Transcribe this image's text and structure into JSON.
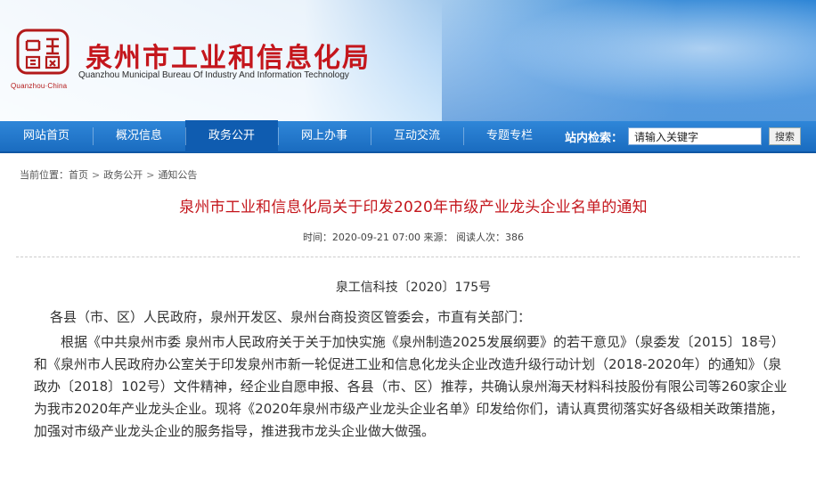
{
  "header": {
    "logo_text": "Quanzhou·China",
    "title": "泉州市工业和信息化局",
    "subtitle": "Quanzhou Municipal Bureau Of Industry And Information Technology"
  },
  "nav": {
    "items": [
      {
        "label": "网站首页"
      },
      {
        "label": "概况信息"
      },
      {
        "label": "政务公开"
      },
      {
        "label": "网上办事"
      },
      {
        "label": "互动交流"
      },
      {
        "label": "专题专栏"
      }
    ],
    "search_label": "站内检索：",
    "search_value": "请输入关键字",
    "search_button": "搜索"
  },
  "breadcrumb": {
    "prefix": "当前位置：",
    "items": [
      "首页",
      "政务公开",
      "通知公告"
    ],
    "separator": ">"
  },
  "article": {
    "title": "泉州市工业和信息化局关于印发2020年市级产业龙头企业名单的通知",
    "meta": "时间：2020-09-21 07:00 来源：  阅读人次：386",
    "doc_number": "泉工信科技〔2020〕175号",
    "salutation": "各县（市、区）人民政府，泉州开发区、泉州台商投资区管委会，市直有关部门：",
    "body": "根据《中共泉州市委 泉州市人民政府关于关于加快实施《泉州制造2025发展纲要》的若干意见》（泉委发〔2015〕18号）和《泉州市人民政府办公室关于印发泉州市新一轮促进工业和信息化龙头企业改造升级行动计划（2018-2020年）的通知》（泉政办〔2018〕102号）文件精神，经企业自愿申报、各县（市、区）推荐，共确认泉州海天材料科技股份有限公司等260家企业为我市2020年产业龙头企业。现将《2020年泉州市级产业龙头企业名单》印发给你们，请认真贯彻落实好各级相关政策措施，加强对市级产业龙头企业的服务指导，推进我市龙头企业做大做强。"
  },
  "colors": {
    "brand_red": "#c4161c",
    "nav_blue": "#1a6cc0"
  }
}
